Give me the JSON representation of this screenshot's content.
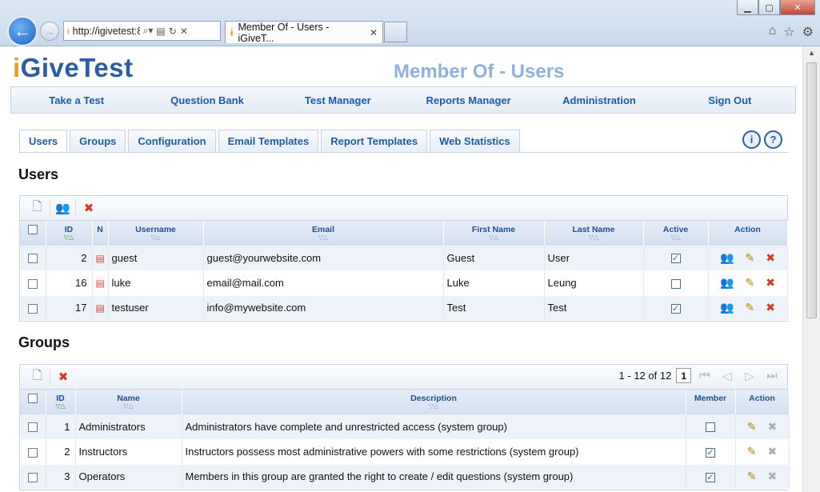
{
  "browser": {
    "address": "http://igivetest:8",
    "tab_title": "Member Of - Users - iGiveT...",
    "icons": [
      "back-icon",
      "forward-icon",
      "search-icon",
      "refresh-icon",
      "stop-icon",
      "home-icon",
      "star-icon",
      "gear-icon"
    ]
  },
  "app": {
    "logo_i": "i",
    "logo_rest": "GiveTest",
    "page_title": "Member Of - Users"
  },
  "menu": [
    "Take a Test",
    "Question Bank",
    "Test Manager",
    "Reports Manager",
    "Administration",
    "Sign Out"
  ],
  "subtabs": [
    "Users",
    "Groups",
    "Configuration",
    "Email Templates",
    "Report Templates",
    "Web Statistics"
  ],
  "users": {
    "heading": "Users",
    "columns": {
      "id": "ID",
      "n": "N",
      "username": "Username",
      "email": "Email",
      "first": "First Name",
      "last": "Last Name",
      "active": "Active",
      "action": "Action"
    },
    "rows": [
      {
        "id": "2",
        "username": "guest",
        "email": "guest@yourwebsite.com",
        "first": "Guest",
        "last": "User",
        "active": "✓"
      },
      {
        "id": "16",
        "username": "luke",
        "email": "email@mail.com",
        "first": "Luke",
        "last": "Leung",
        "active": ""
      },
      {
        "id": "17",
        "username": "testuser",
        "email": "info@mywebsite.com",
        "first": "Test",
        "last": "Test",
        "active": "✓"
      }
    ]
  },
  "groups": {
    "heading": "Groups",
    "pager_text": "1 - 12 of 12",
    "page": "1",
    "columns": {
      "id": "ID",
      "name": "Name",
      "description": "Description",
      "member": "Member",
      "action": "Action"
    },
    "rows": [
      {
        "id": "1",
        "name": "Administrators",
        "description": "Administrators have complete and unrestricted access (system group)",
        "member": ""
      },
      {
        "id": "2",
        "name": "Instructors",
        "description": "Instructors possess most administrative powers with some restrictions (system group)",
        "member": "✓"
      },
      {
        "id": "3",
        "name": "Operators",
        "description": "Members in this group are granted the right to create / edit questions (system group)",
        "member": "✓"
      }
    ]
  }
}
